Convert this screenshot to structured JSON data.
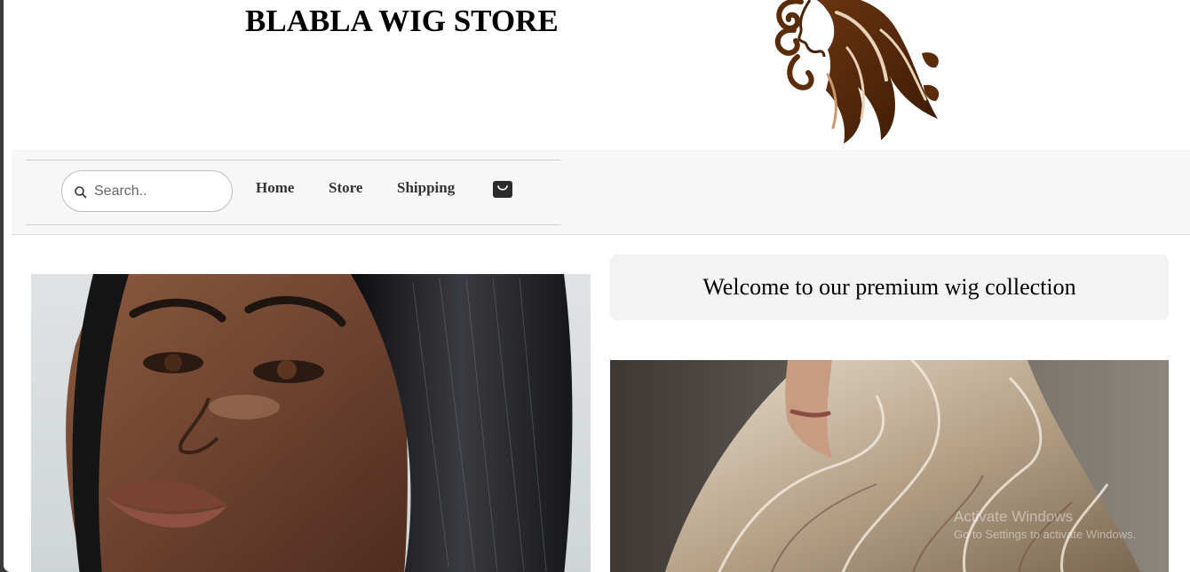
{
  "header": {
    "store_title": "BLABLA WIG STORE",
    "logo_icon": "wavy-hair-woman-logo",
    "logo_color": "#4a2408"
  },
  "nav": {
    "search_placeholder": "Search..",
    "links": [
      "Home",
      "Store",
      "Shipping"
    ],
    "cart_icon": "shopping-bag-icon"
  },
  "main": {
    "welcome_text": "Welcome to our premium wig collection",
    "left_image": "model with long straight black hair",
    "right_image": "model with long wavy blonde hair"
  },
  "watermark": {
    "title": "Activate Windows",
    "subtitle": "Go to Settings to activate Windows."
  }
}
